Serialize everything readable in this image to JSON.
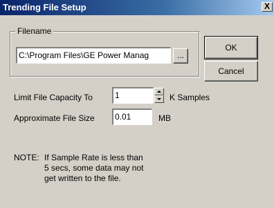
{
  "dialog": {
    "title": "Trending File Setup",
    "close_glyph": "X"
  },
  "filename_group": {
    "label": "Filename",
    "path_value": "C:\\Program Files\\GE Power Manag",
    "browse_label": "..."
  },
  "buttons": {
    "ok_label": "OK",
    "cancel_label": "Cancel"
  },
  "capacity": {
    "label": "Limit File Capacity To",
    "value": "1",
    "unit": "K Samples"
  },
  "file_size": {
    "label": "Approximate File Size",
    "value": "0.01",
    "unit": "MB"
  },
  "note": {
    "prefix": "NOTE:",
    "lines": [
      "If Sample Rate is less than",
      "5 secs, some data may not",
      "get written to the file."
    ]
  },
  "icons": {
    "spin_up": "arrow-up-icon",
    "spin_down": "arrow-down-icon"
  }
}
